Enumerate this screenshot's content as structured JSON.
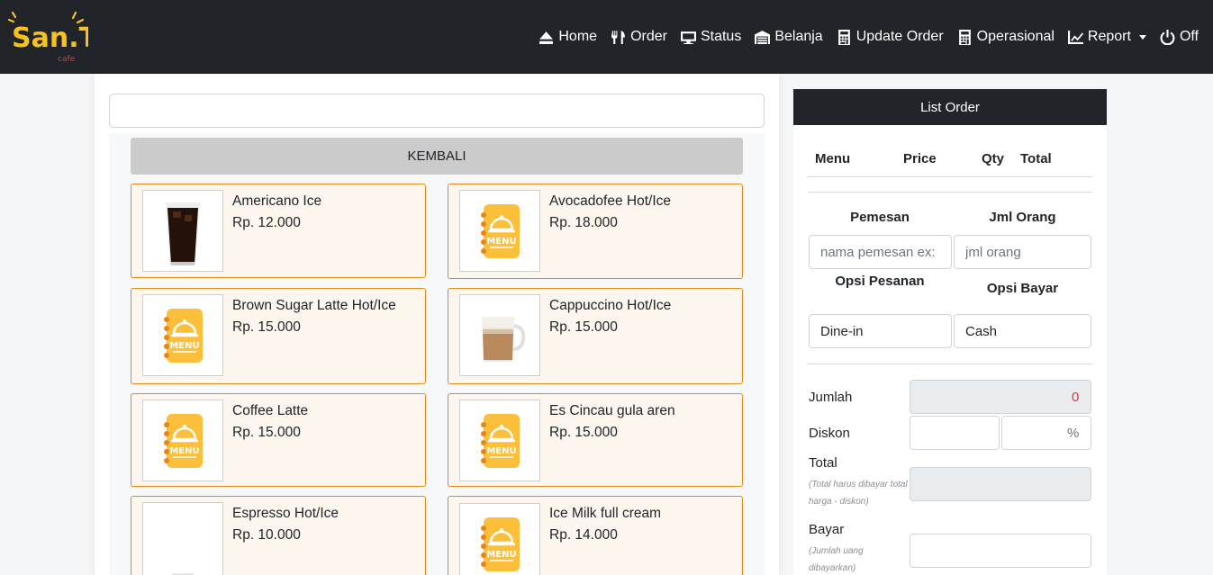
{
  "brand": {
    "logo_text": "San.Te",
    "logo_sub": "cafe"
  },
  "nav": [
    {
      "label": "Home",
      "icon": "eject-icon"
    },
    {
      "label": "Order",
      "icon": "utensils-icon"
    },
    {
      "label": "Status",
      "icon": "monitor-icon"
    },
    {
      "label": "Belanja",
      "icon": "warehouse-icon"
    },
    {
      "label": "Update Order",
      "icon": "calculator-icon"
    },
    {
      "label": "Operasional",
      "icon": "calculator-icon"
    },
    {
      "label": "Report",
      "icon": "line-chart-icon"
    },
    {
      "label": "Off",
      "icon": "power-icon"
    }
  ],
  "search": {
    "value": ""
  },
  "back_label": "KEMBALI",
  "menu_items": [
    {
      "name": "Americano Ice",
      "price": "Rp. 12.000",
      "image": "iced-coffee-photo"
    },
    {
      "name": "Avocadofee Hot/Ice",
      "price": "Rp. 18.000",
      "image": "menu-placeholder-icon"
    },
    {
      "name": "Brown Sugar Latte Hot/Ice",
      "price": "Rp. 15.000",
      "image": "menu-placeholder-icon"
    },
    {
      "name": "Cappuccino Hot/Ice",
      "price": "Rp. 15.000",
      "image": "cappuccino-photo"
    },
    {
      "name": "Coffee Latte",
      "price": "Rp. 15.000",
      "image": "menu-placeholder-icon"
    },
    {
      "name": "Es Cincau gula aren",
      "price": "Rp. 15.000",
      "image": "menu-placeholder-icon"
    },
    {
      "name": "Espresso Hot/Ice",
      "price": "Rp. 10.000",
      "image": "espresso-photo"
    },
    {
      "name": "Ice Milk full cream",
      "price": "Rp. 14.000",
      "image": "menu-placeholder-icon"
    }
  ],
  "order": {
    "header": "List Order",
    "columns": [
      "Menu",
      "Price",
      "Qty",
      "Total"
    ],
    "pemesan_label": "Pemesan",
    "jml_label": "Jml Orang",
    "pemesan_placeholder": "nama pemesan ex: Dika",
    "jml_placeholder": "jml orang",
    "opsi_pesanan_label": "Opsi Pesanan",
    "opsi_bayar_label": "Opsi Bayar",
    "opsi_pesanan_value": "Dine-in",
    "opsi_bayar_value": "Cash",
    "jumlah_label": "Jumlah",
    "jumlah_value": "0",
    "diskon_label": "Diskon",
    "diskon_pct": "%",
    "total_label": "Total",
    "total_note": "(Total harus dibayar total harga - diskon)",
    "bayar_label": "Bayar",
    "bayar_note": "(Jumlah uang dibayarkan)"
  },
  "colors": {
    "navbar": "#212529",
    "card_border": "#e38a1c",
    "card_bg": "#fdf6ef",
    "menu_icon": "#fbbf3a",
    "accent_red": "#dc3545"
  }
}
